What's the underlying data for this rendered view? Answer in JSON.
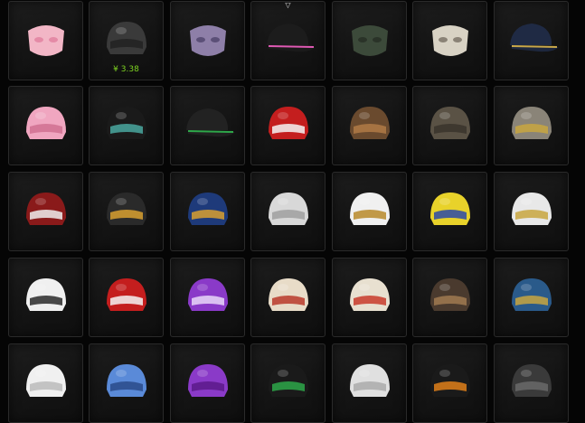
{
  "inventory": {
    "columns": 7,
    "selected_index": 3,
    "items": [
      {
        "name": "pink-pig-mask-icon",
        "price": "",
        "c1": "#f2b6c6",
        "c2": "#e48aa6"
      },
      {
        "name": "police-bobby-helmet-icon",
        "price": "¥ 3.38",
        "c1": "#3a3a3a",
        "c2": "#222"
      },
      {
        "name": "gas-mask-icon",
        "price": "",
        "c1": "#8e7fa8",
        "c2": "#5b4f77"
      },
      {
        "name": "black-cap-pink-trim-icon",
        "price": "",
        "c1": "#1c1c1c",
        "c2": "#e05ab4"
      },
      {
        "name": "green-face-scarf-icon",
        "price": "",
        "c1": "#3c4a3a",
        "c2": "#2a3328"
      },
      {
        "name": "skull-mask-icon",
        "price": "",
        "c1": "#d8d2c4",
        "c2": "#8a8276"
      },
      {
        "name": "officer-peaked-cap-icon",
        "price": "",
        "c1": "#1f2a44",
        "c2": "#c9a84a"
      },
      {
        "name": "pink-bunny-ears-helmet-icon",
        "price": "",
        "c1": "#f0a6c0",
        "c2": "#d07090"
      },
      {
        "name": "tactical-glasses-headset-icon",
        "price": "",
        "c1": "#1a1a1a",
        "c2": "#4aa8a0"
      },
      {
        "name": "black-baseball-cap-icon",
        "price": "",
        "c1": "#222",
        "c2": "#2ea84a"
      },
      {
        "name": "santa-hat-helmet-icon",
        "price": "",
        "c1": "#c41e1e",
        "c2": "#f4f4f4"
      },
      {
        "name": "reindeer-antler-helmet-icon",
        "price": "",
        "c1": "#6a4a2e",
        "c2": "#b07a45"
      },
      {
        "name": "plaid-brimmed-helmet-icon",
        "price": "",
        "c1": "#5a5245",
        "c2": "#3a342c"
      },
      {
        "name": "star-camo-helmet-icon",
        "price": "",
        "c1": "#8a8478",
        "c2": "#c8a640"
      },
      {
        "name": "red-polka-dot-helmet-icon",
        "price": "",
        "c1": "#8a1a1a",
        "c2": "#eeeeee"
      },
      {
        "name": "gold-flame-helmet-icon",
        "price": "",
        "c1": "#2a2a2a",
        "c2": "#d8a030"
      },
      {
        "name": "blue-gold-winged-helmet-icon",
        "price": "",
        "c1": "#1e3a7a",
        "c2": "#d8a030"
      },
      {
        "name": "viking-horned-helmet-icon",
        "price": "",
        "c1": "#d8d8d8",
        "c2": "#a0a0a0"
      },
      {
        "name": "astronaut-gold-visor-helmet-icon",
        "price": "",
        "c1": "#f0f0f0",
        "c2": "#b88a2a"
      },
      {
        "name": "yellow-motocross-helmet-icon",
        "price": "",
        "c1": "#e8d22a",
        "c2": "#2a4aa8"
      },
      {
        "name": "gold-star-white-helmet-icon",
        "price": "",
        "c1": "#e8e8e8",
        "c2": "#c8a640"
      },
      {
        "name": "white-winged-level3-helmet-icon",
        "price": "",
        "c1": "#f0f0f0",
        "c2": "#2a2a2a"
      },
      {
        "name": "jester-helmet-icon",
        "price": "",
        "c1": "#c41e1e",
        "c2": "#f4f4f4"
      },
      {
        "name": "purple-pattern-helmet-icon",
        "price": "",
        "c1": "#8a3ac8",
        "c2": "#e8d8f8"
      },
      {
        "name": "vintage-red-stripe-helmet-icon",
        "price": "",
        "c1": "#e8dcc8",
        "c2": "#b83a2a"
      },
      {
        "name": "retro-red-white-helmet-icon",
        "price": "",
        "c1": "#e8e0d0",
        "c2": "#c83a2a"
      },
      {
        "name": "spiked-bronze-helmet-icon",
        "price": "",
        "c1": "#4a3a2e",
        "c2": "#a07a50"
      },
      {
        "name": "blue-ornate-level3-helmet-icon",
        "price": "",
        "c1": "#2a5a8a",
        "c2": "#c8a640"
      },
      {
        "name": "white-round-helmet-icon",
        "price": "",
        "c1": "#f0f0f0",
        "c2": "#bbb"
      },
      {
        "name": "blue-sphere-helmet-icon",
        "price": "",
        "c1": "#5a8ad8",
        "c2": "#2a4a8a"
      },
      {
        "name": "purple-dome-helmet-icon",
        "price": "",
        "c1": "#8a3ac8",
        "c2": "#5a1a8a"
      },
      {
        "name": "green-trim-helmet-icon",
        "price": "",
        "c1": "#1a1a1a",
        "c2": "#2ea84a"
      },
      {
        "name": "white-bear-ears-helmet-icon",
        "price": "",
        "c1": "#e0e0e0",
        "c2": "#aaa"
      },
      {
        "name": "orange-accent-helmet-icon",
        "price": "",
        "c1": "#1a1a1a",
        "c2": "#e0801a"
      },
      {
        "name": "dark-grey-helmet-icon",
        "price": "",
        "c1": "#3a3a3a",
        "c2": "#6a6a6a"
      }
    ]
  }
}
